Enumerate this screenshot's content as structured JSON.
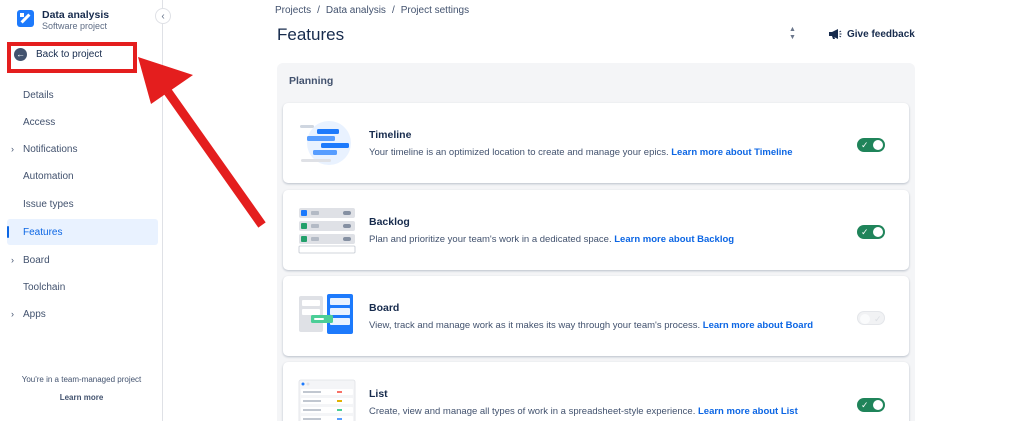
{
  "project": {
    "name": "Data analysis",
    "type": "Software project"
  },
  "sidebar": {
    "back_label": "Back to project",
    "items": [
      {
        "label": "Details",
        "has_chevron": false,
        "active": false
      },
      {
        "label": "Access",
        "has_chevron": false,
        "active": false
      },
      {
        "label": "Notifications",
        "has_chevron": true,
        "active": false
      },
      {
        "label": "Automation",
        "has_chevron": false,
        "active": false
      },
      {
        "label": "Issue types",
        "has_chevron": false,
        "active": false
      },
      {
        "label": "Features",
        "has_chevron": false,
        "active": true
      },
      {
        "label": "Board",
        "has_chevron": true,
        "active": false
      },
      {
        "label": "Toolchain",
        "has_chevron": false,
        "active": false
      },
      {
        "label": "Apps",
        "has_chevron": true,
        "active": false
      }
    ],
    "footer_note": "You're in a team-managed project",
    "footer_link": "Learn more"
  },
  "breadcrumb": [
    "Projects",
    "Data analysis",
    "Project settings"
  ],
  "page_title": "Features",
  "feedback_label": "Give feedback",
  "section_title": "Planning",
  "features": [
    {
      "title": "Timeline",
      "description": "Your timeline is an optimized location to create and manage your epics.",
      "link": "Learn more about Timeline",
      "enabled": true,
      "icon": "timeline-illustration"
    },
    {
      "title": "Backlog",
      "description": "Plan and prioritize your team's work in a dedicated space.",
      "link": "Learn more about Backlog",
      "enabled": true,
      "icon": "backlog-illustration"
    },
    {
      "title": "Board",
      "description": "View, track and manage work as it makes its way through your team's process.",
      "link": "Learn more about Board",
      "enabled": false,
      "icon": "board-illustration"
    },
    {
      "title": "List",
      "description": "Create, view and manage all types of work in a spreadsheet-style experience.",
      "link": "Learn more about List",
      "enabled": true,
      "icon": "list-illustration"
    }
  ],
  "colors": {
    "accent": "#0c66e4",
    "toggle_on": "#1f845a",
    "annotation": "#e41e1e"
  }
}
